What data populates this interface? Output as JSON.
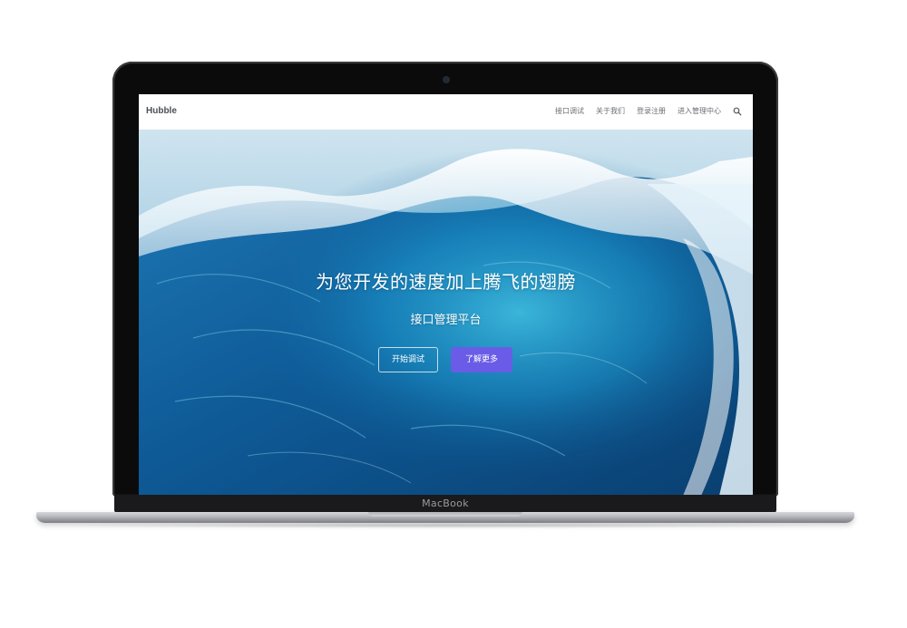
{
  "device": {
    "label": "MacBook"
  },
  "navbar": {
    "brand": "Hubble",
    "links": [
      {
        "label": "接口调试"
      },
      {
        "label": "关于我们"
      },
      {
        "label": "登录注册"
      },
      {
        "label": "进入管理中心"
      }
    ],
    "search_icon": "search-icon"
  },
  "hero": {
    "title": "为您开发的速度加上腾飞的翅膀",
    "subtitle": "接口管理平台",
    "primary_cta": "了解更多",
    "secondary_cta": "开始调试",
    "background": "ocean-wave-image",
    "accent_color": "#6a5ce6"
  }
}
